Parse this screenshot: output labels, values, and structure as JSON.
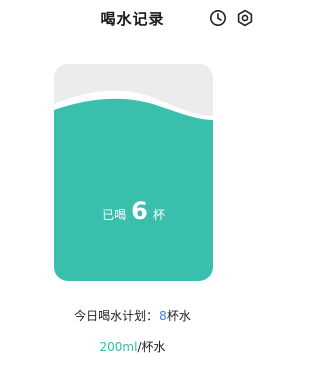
{
  "header": {
    "title": "喝水记录",
    "icons": [
      "clock-icon",
      "settings-icon"
    ]
  },
  "cup": {
    "prefix": "已喝",
    "count": "6",
    "suffix": "杯",
    "fill_level": 0.84,
    "water_color": "#3bbfad",
    "wave_color": "#ffffff",
    "cup_bg_color": "#ececee"
  },
  "plan": {
    "label": "今日水计划：",
    "label_display": "今日喝水计划：",
    "value": "8",
    "value_suffix": "杯水",
    "value_color": "#3d7fd9"
  },
  "unit": {
    "amount": "200ml",
    "per": "/杯水",
    "amount_color": "#2dbfa7"
  }
}
